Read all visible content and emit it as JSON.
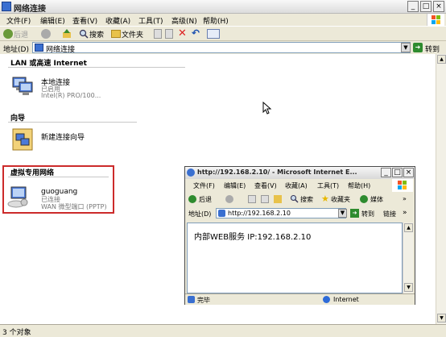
{
  "window": {
    "title": "网络连接",
    "min": "_",
    "max": "□",
    "close": "×"
  },
  "menu": [
    "文件(F)",
    "编辑(E)",
    "查看(V)",
    "收藏(A)",
    "工具(T)",
    "高级(N)",
    "帮助(H)"
  ],
  "toolbar": {
    "back": "后退",
    "search": "搜索",
    "folders": "文件夹"
  },
  "address": {
    "label": "地址(D)",
    "value": "网络连接",
    "go": "转到"
  },
  "groups": {
    "lan": "LAN 或高速 Internet",
    "wizard": "向导",
    "vpn": "虚拟专用网络"
  },
  "items": {
    "local": {
      "name": "本地连接",
      "status": "已启用",
      "device": "Intel(R) PRO/100..."
    },
    "wizard": {
      "name": "新建连接向导"
    },
    "vpn": {
      "name": "guoguang",
      "status": "已连接",
      "device": "WAN 微型端口 (PPTP)"
    }
  },
  "status": {
    "text": "3 个对象"
  },
  "ie": {
    "title": "http://192.168.2.10/ - Microsoft Internet E...",
    "menu": [
      "文件(F)",
      "编辑(E)",
      "查看(V)",
      "收藏(A)",
      "工具(T)",
      "帮助(H)"
    ],
    "toolbar": {
      "back": "后退",
      "search": "搜索",
      "favorites": "收藏夹",
      "media": "媒体"
    },
    "address_label": "地址(D)",
    "address_value": "http://192.168.2.10",
    "go": "转到",
    "links": "链接",
    "body": "内部WEB服务 IP:192.168.2.10",
    "status_done": "完毕",
    "zone": "Internet"
  },
  "icons": [
    "back-icon",
    "forward-icon",
    "up-icon",
    "search-icon",
    "folders-icon",
    "delete-icon",
    "undo-icon",
    "views-icon",
    "network-icon",
    "wizard-icon",
    "vpn-icon",
    "windows-flag-icon",
    "cursor-icon",
    "refresh-icon",
    "home-icon",
    "media-icon"
  ],
  "colors": {
    "highlight": "#cc2b2b",
    "link_blue": "#003399"
  }
}
